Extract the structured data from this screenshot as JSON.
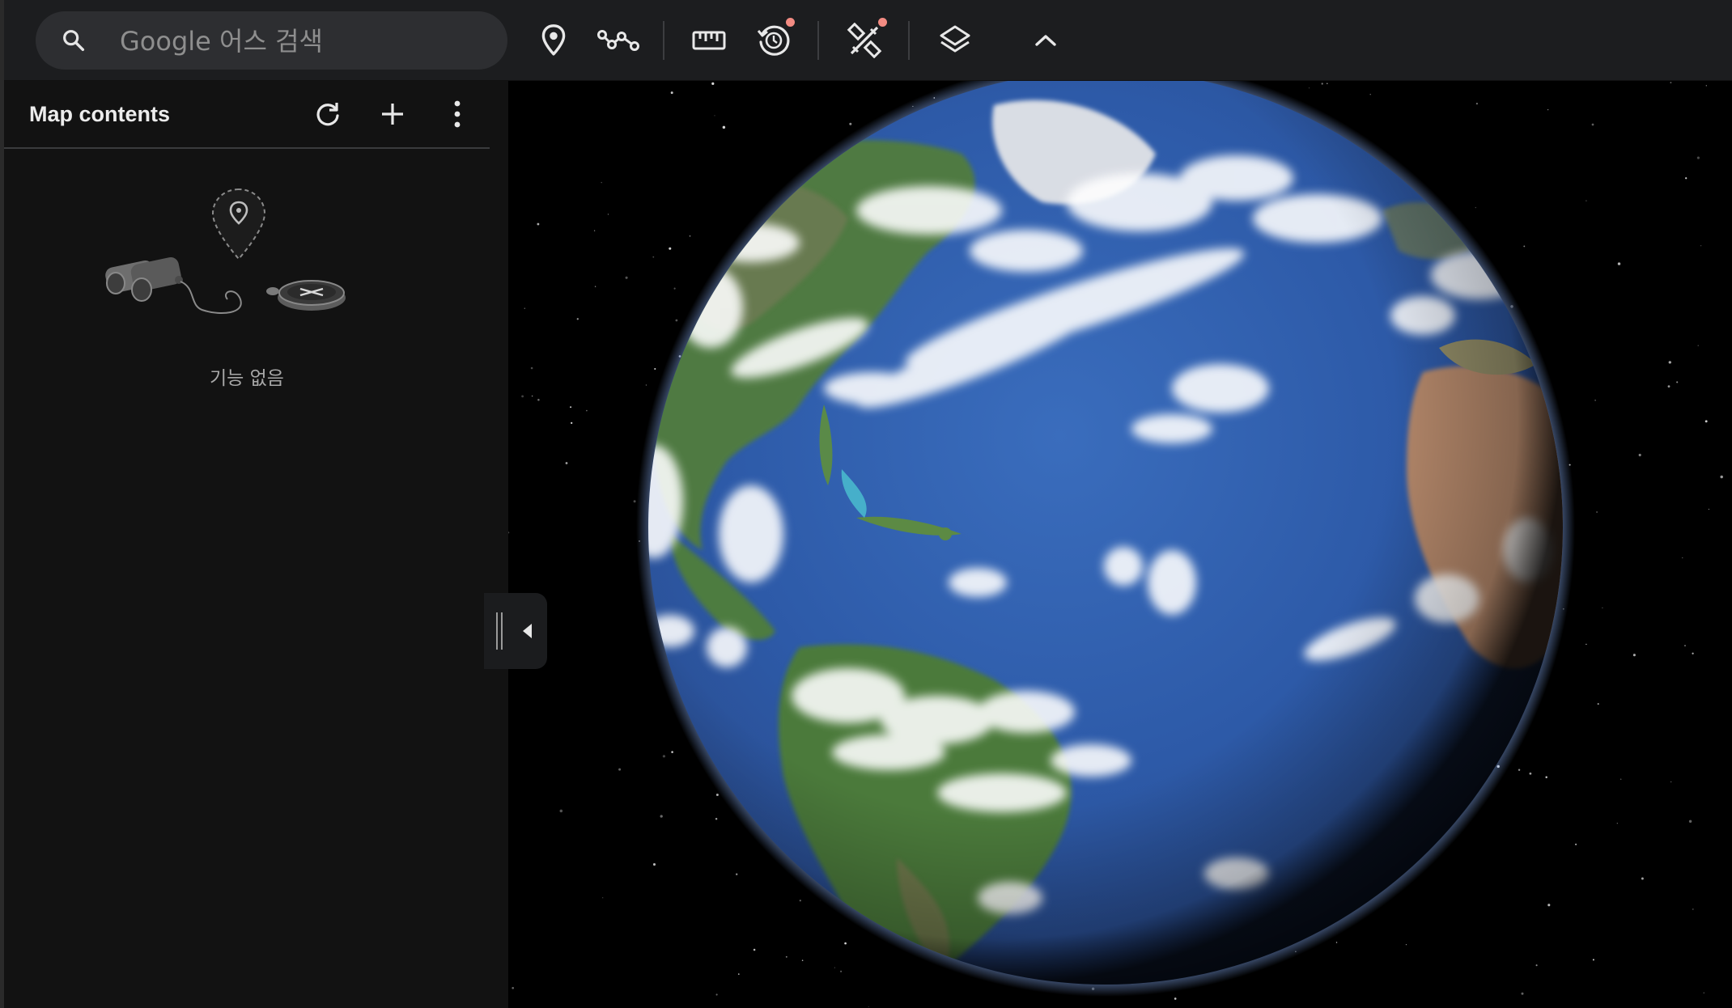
{
  "search": {
    "placeholder": "Google 어스 검색",
    "value": ""
  },
  "toolbar": {
    "tools": [
      {
        "name": "add-placemark",
        "icon": "map-pin-icon",
        "badge": false
      },
      {
        "name": "add-path",
        "icon": "path-icon",
        "badge": false
      },
      {
        "name": "measure",
        "icon": "ruler-icon",
        "badge": false
      },
      {
        "name": "historical-imagery",
        "icon": "history-icon",
        "badge": true
      },
      {
        "name": "projects",
        "icon": "satellite-tools-icon",
        "badge": true
      },
      {
        "name": "map-style",
        "icon": "layers-icon",
        "badge": false
      },
      {
        "name": "collapse-toolbar",
        "icon": "chevron-up-icon",
        "badge": false
      }
    ],
    "badge_color": "#f28b82"
  },
  "sidebar": {
    "title": "Map contents",
    "actions": [
      {
        "name": "refresh",
        "icon": "refresh-icon"
      },
      {
        "name": "add",
        "icon": "plus-icon"
      },
      {
        "name": "more",
        "icon": "more-vert-icon"
      }
    ],
    "empty_state": {
      "illustration": "binoculars-compass-pin-illustration",
      "label": "기능 없음"
    },
    "collapse_handle": {
      "icon": "chevron-left-icon"
    }
  },
  "map": {
    "view": "earth-globe-atlantic",
    "background": "#000000",
    "ocean_color": "#2f5fae",
    "land_color": "#4e7a3c"
  },
  "colors": {
    "toolbar_bg": "#1c1d1f",
    "sidebar_bg": "#121212",
    "search_bg": "#2d2e31",
    "icon": "#e8e8e8"
  }
}
